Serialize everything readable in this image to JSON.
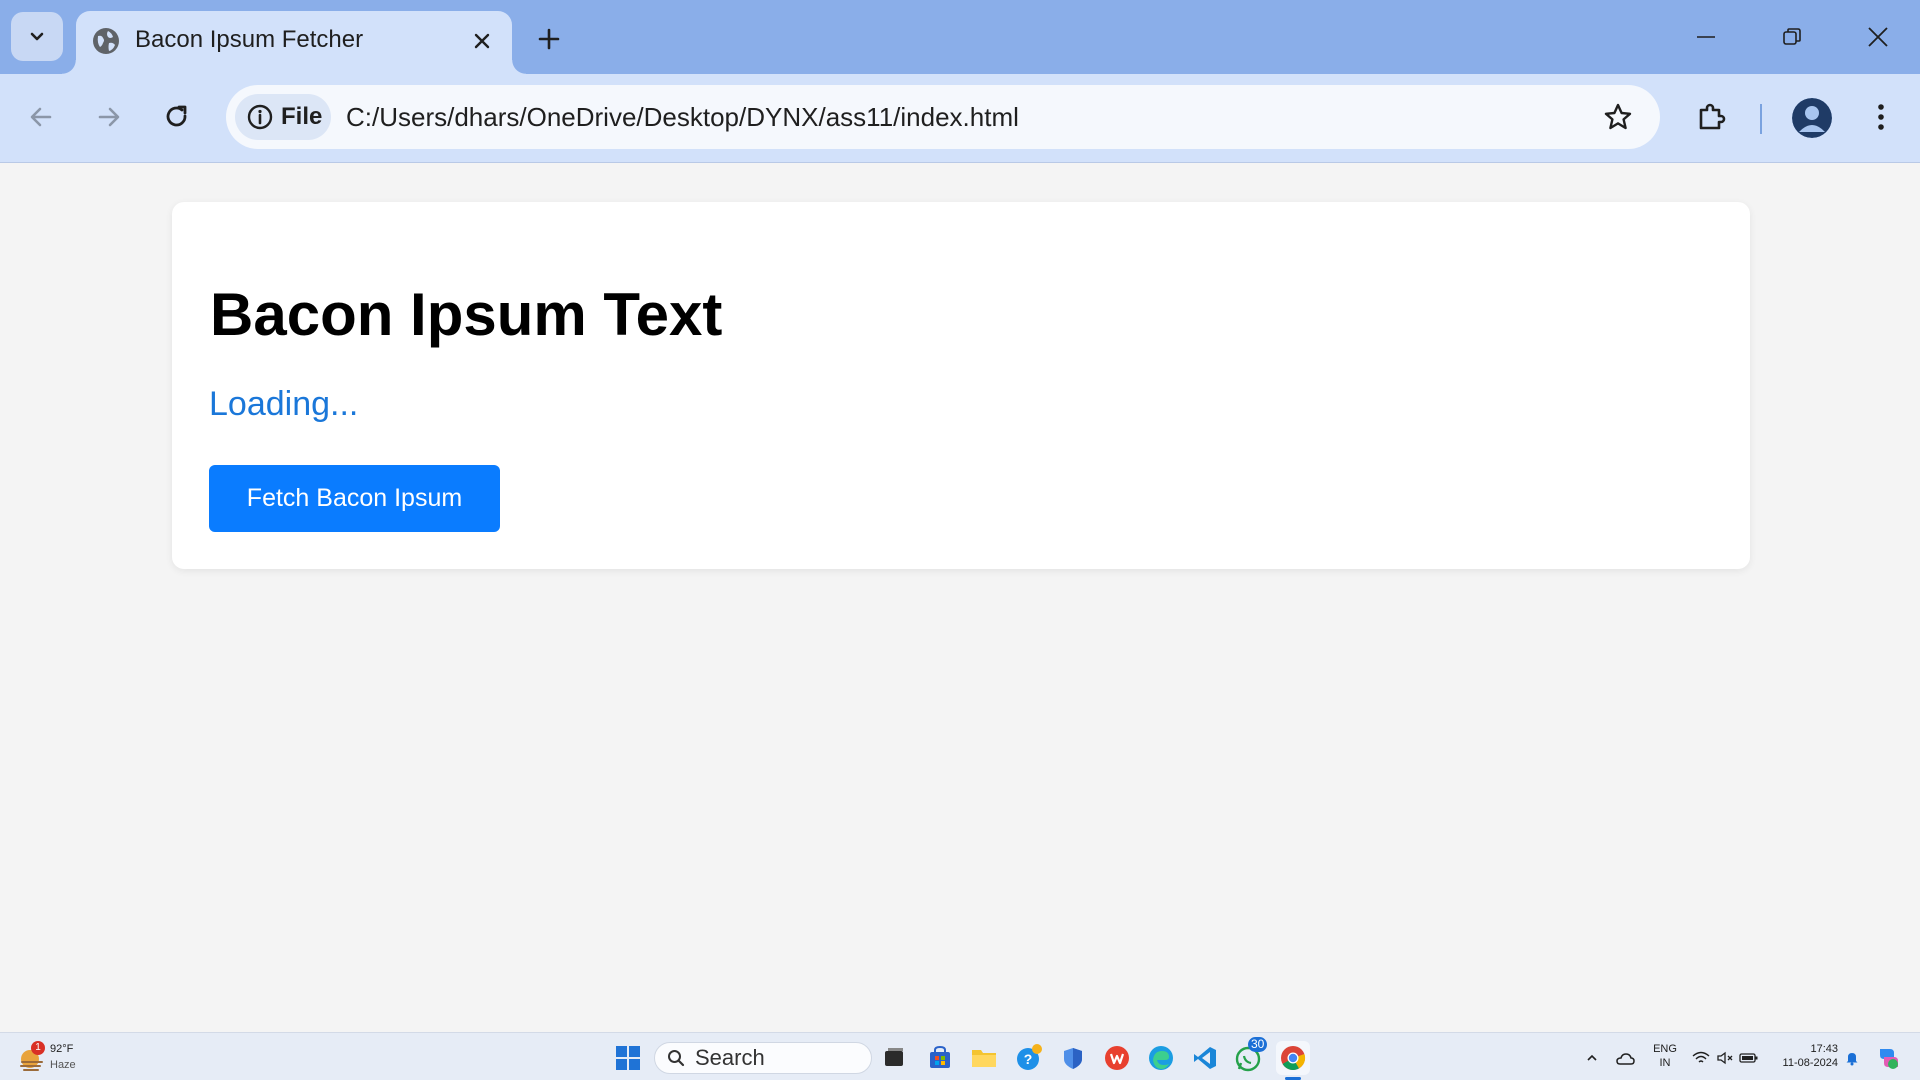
{
  "browser": {
    "tab_title": "Bacon Ipsum Fetcher",
    "site_chip_label": "File",
    "url": "C:/Users/dhars/OneDrive/Desktop/DYNX/ass11/index.html"
  },
  "page": {
    "heading": "Bacon Ipsum Text",
    "status": "Loading...",
    "button_label": "Fetch Bacon Ipsum"
  },
  "taskbar": {
    "weather_temp": "92°F",
    "weather_condition": "Haze",
    "weather_badge": "1",
    "search_label": "Search",
    "whatsapp_badge": "30",
    "language": "ENG",
    "region": "IN",
    "time": "17:43",
    "date": "11-08-2024"
  },
  "colors": {
    "tabstrip": "#8aaee9",
    "toolbar": "#d2e1fa",
    "accent_button": "#0a7cff",
    "status_text": "#1a77d9",
    "page_background": "#f4f4f4"
  }
}
